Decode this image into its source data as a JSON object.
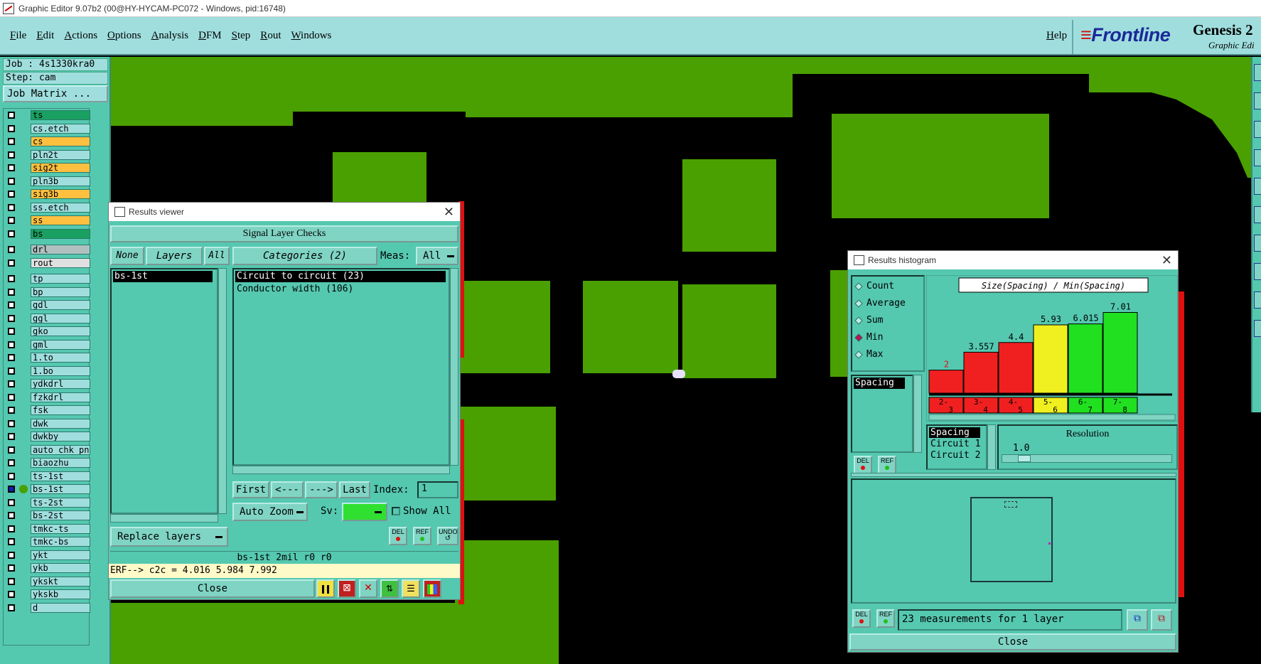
{
  "window": {
    "title": "Graphic Editor 9.07b2 (00@HY-HYCAM-PC072 - Windows, pid:16748)"
  },
  "menu": [
    "File",
    "Edit",
    "Actions",
    "Options",
    "Analysis",
    "DFM",
    "Step",
    "Rout",
    "Windows"
  ],
  "help_label": "Help",
  "brand": {
    "logo": "Frontline",
    "product": "Genesis 2",
    "subtitle": "Graphic Edi"
  },
  "job": {
    "job_line": "Job : 4s1330kra0",
    "step_line": "Step: cam",
    "matrix_button": "Job Matrix ..."
  },
  "layers": [
    {
      "name": "ts",
      "color": "#1aa060"
    },
    {
      "name": "cs.etch",
      "color": "#a0dede"
    },
    {
      "name": "cs",
      "color": "#ffc040"
    },
    {
      "name": "pln2t",
      "color": "#a0dede"
    },
    {
      "name": "sig2t",
      "color": "#ffc040"
    },
    {
      "name": "pln3b",
      "color": "#a0dede"
    },
    {
      "name": "sig3b",
      "color": "#ffc040"
    },
    {
      "name": "ss.etch",
      "color": "#a0dede"
    },
    {
      "name": "ss",
      "color": "#ffc040"
    },
    {
      "name": "bs",
      "color": "#1aa060"
    },
    {
      "name": "drl",
      "color": "#b0c0c0"
    },
    {
      "name": "rout",
      "color": "#e0e0e0"
    },
    {
      "name": "tp",
      "color": "#a0dede"
    },
    {
      "name": "bp",
      "color": "#a0dede"
    },
    {
      "name": "gdl",
      "color": "#a0dede"
    },
    {
      "name": "ggl",
      "color": "#a0dede"
    },
    {
      "name": "gko",
      "color": "#a0dede"
    },
    {
      "name": "gml",
      "color": "#a0dede"
    },
    {
      "name": "1.to",
      "color": "#a0dede"
    },
    {
      "name": "1.bo",
      "color": "#a0dede"
    },
    {
      "name": "ydkdrl",
      "color": "#a0dede"
    },
    {
      "name": "fzkdrl",
      "color": "#a0dede"
    },
    {
      "name": "fsk",
      "color": "#a0dede"
    },
    {
      "name": "dwk",
      "color": "#a0dede"
    },
    {
      "name": "dwkby",
      "color": "#a0dede"
    },
    {
      "name": "auto_chk_pn.",
      "color": "#a0dede"
    },
    {
      "name": "biaozhu",
      "color": "#a0dede"
    },
    {
      "name": "ts-1st",
      "color": "#a0dede"
    },
    {
      "name": "bs-1st",
      "color": "#a0dede",
      "active": true
    },
    {
      "name": "ts-2st",
      "color": "#a0dede"
    },
    {
      "name": "bs-2st",
      "color": "#a0dede"
    },
    {
      "name": "tmkc-ts",
      "color": "#a0dede"
    },
    {
      "name": "tmkc-bs",
      "color": "#a0dede"
    },
    {
      "name": "ykt",
      "color": "#a0dede"
    },
    {
      "name": "ykb",
      "color": "#a0dede"
    },
    {
      "name": "ykskt",
      "color": "#a0dede"
    },
    {
      "name": "ykskb",
      "color": "#a0dede"
    },
    {
      "name": "d",
      "color": "#a0dede"
    }
  ],
  "results_viewer": {
    "title": "Results viewer",
    "header": "Signal Layer Checks",
    "none_btn": "None",
    "layers_btn": "Layers",
    "all_btn": "All",
    "categories_btn": "Categories (2)",
    "meas_label": "Meas:",
    "meas_value": "All",
    "layer_items": [
      "bs-1st"
    ],
    "categories": [
      "Circuit to circuit (23)",
      "Conductor width (106)"
    ],
    "first": "First",
    "prev": "<---",
    "next": "--->",
    "last": "Last",
    "index_label": "Index:",
    "index_value": "1",
    "auto_zoom": "Auto Zoom",
    "sv_label": "Sv:",
    "show_all": "Show All",
    "replace_layers": "Replace layers",
    "del": "DEL",
    "ref": "REF",
    "undo": "UNDO",
    "status": "bs-1st 2mil  r0  r0",
    "erf": "ERF--> c2c = 4.016 5.984 7.992",
    "close": "Close"
  },
  "histogram": {
    "title": "Results histogram",
    "stats": [
      "Count",
      "Average",
      "Sum",
      "Min",
      "Max"
    ],
    "selected_stat": "Min",
    "measure_items": [
      "Spacing"
    ],
    "chart_title": "Size(Spacing) / Min(Spacing)",
    "resolution_label": "Resolution",
    "resolution_value": "1.0",
    "axis_items": [
      "Spacing",
      "Circuit 1",
      "Circuit 2"
    ],
    "summary": "23 measurements for 1 layer",
    "close": "Close",
    "del": "DEL",
    "ref": "REF"
  },
  "chart_data": {
    "type": "bar",
    "title": "Size(Spacing) / Min(Spacing)",
    "categories": [
      "2-3",
      "3-4",
      "4-5",
      "5-6",
      "6-7",
      "7-8"
    ],
    "values": [
      2,
      3.557,
      4.4,
      5.93,
      6.015,
      7.01
    ],
    "labels": [
      "2",
      "3.557",
      "4.4",
      "5.93",
      "6.015",
      "7.01"
    ],
    "colors": [
      "#f02020",
      "#f02020",
      "#f02020",
      "#f0f020",
      "#20e020",
      "#20e020"
    ],
    "ylim": [
      0,
      7.5
    ]
  },
  "colors": {
    "board": "#4aa000",
    "bg": "#000000",
    "panel": "#55c8b0",
    "menu": "#a0dede"
  }
}
